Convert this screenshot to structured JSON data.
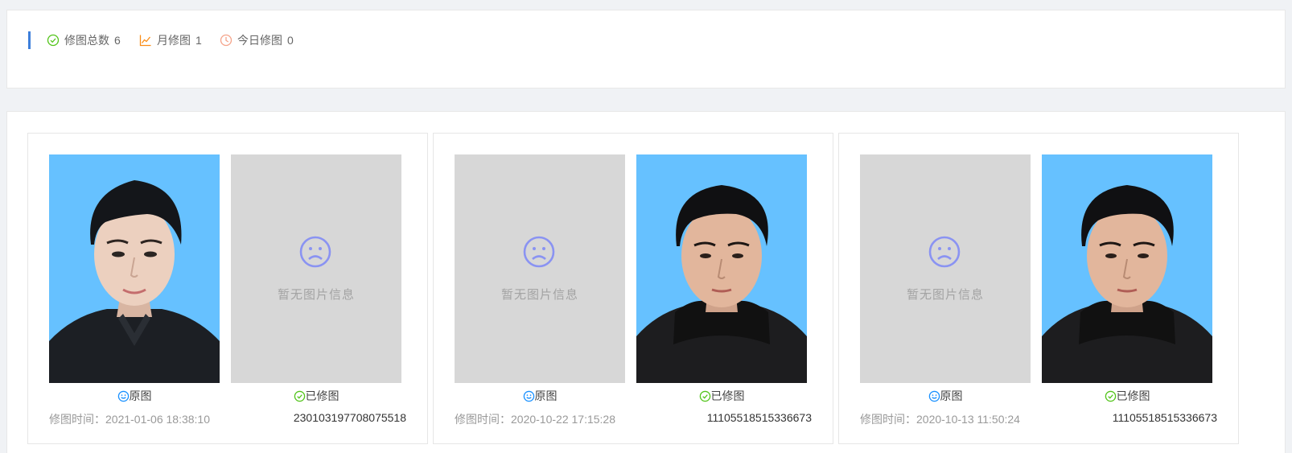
{
  "stats": {
    "total_label": "修图总数",
    "total_value": "6",
    "month_label": "月修图",
    "month_value": "1",
    "today_label": "今日修图",
    "today_value": "0",
    "colors": {
      "accent_bar": "#3d7fdb",
      "total_icon": "#52c41a",
      "month_icon": "#fa8c16",
      "today_icon": "#f5a38a"
    }
  },
  "cards": [
    {
      "left_photo": "portrait",
      "right_photo": "empty",
      "empty_text": "暂无图片信息",
      "original_label": "原图",
      "retouched_label": "已修图",
      "time_label": "修图时间：2021-01-06 18:38:10",
      "id": "230103197708075518"
    },
    {
      "left_photo": "empty",
      "right_photo": "portrait",
      "empty_text": "暂无图片信息",
      "original_label": "原图",
      "retouched_label": "已修图",
      "time_label": "修图时间：2020-10-22 17:15:28",
      "id": "11105518515336673"
    },
    {
      "left_photo": "empty",
      "right_photo": "portrait",
      "empty_text": "暂无图片信息",
      "original_label": "原图",
      "retouched_label": "已修图",
      "time_label": "修图时间：2020-10-13 11:50:24",
      "id": "11105518515336673"
    }
  ],
  "icons": {
    "original": "smile-icon",
    "retouched": "check-circle-icon",
    "empty": "sad-face-icon"
  }
}
